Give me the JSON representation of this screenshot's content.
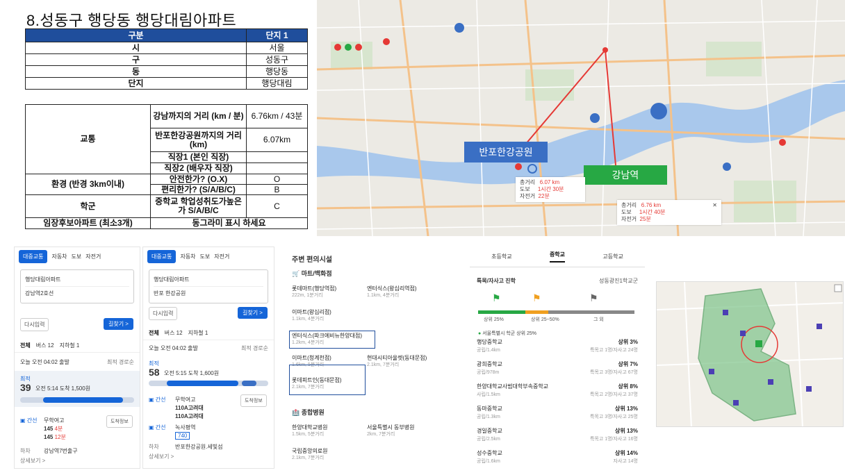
{
  "heading": "8.성동구 행당동  행당대림아파트",
  "table1": {
    "header": [
      "구분",
      "단지 1"
    ],
    "rows": [
      {
        "label": "시",
        "value": "서울"
      },
      {
        "label": "구",
        "value": "성동구"
      },
      {
        "label": "동",
        "value": "행당동"
      },
      {
        "label": "단지",
        "value": "행당대림"
      }
    ]
  },
  "table2": {
    "transport": "교통",
    "gangnam_q": "강남까지의 거리 (km / 분)",
    "gangnam_v": "6.76km / 43분",
    "banpo_q": "반포한강공원까지의 거리 (km)",
    "banpo_v": "6.07km",
    "job1": "직장1 (본인 직장)",
    "job2": "직장2 (배우자 직장)",
    "env": "환경 (반경 3km이내)",
    "safe_q": "안전한가? (O.X)",
    "safe_v": "O",
    "conv_q": "편리한가? (S/A/B/C)",
    "conv_v": "B",
    "school": "학군",
    "school_q": "중학교 학업성취도가높은가 S/A/B/C",
    "school_v": "C",
    "rent": "임장후보아파트 (최소3개)",
    "rent_v": "동그라미 표시 하세요"
  },
  "map": {
    "banpo_label": "반포한강공원",
    "gangnam_label": "강남역",
    "info1": {
      "k1": "총거리",
      "v1": "6.07 km",
      "k2": "도보",
      "v2": "1시간 30분",
      "k3": "자전거",
      "v3": "22분"
    },
    "info2": {
      "k1": "총거리",
      "v1": "6.76 km",
      "k2": "도보",
      "v2": "1시간 40분",
      "k3": "자전거",
      "v3": "25분"
    },
    "colors": {
      "water": "#a9c8ec",
      "land": "#eceae4",
      "park": "#cfe3c4",
      "banpo": "#3a6fc4",
      "gangnam": "#27a844"
    }
  },
  "route1": {
    "modes": [
      "대중교통",
      "자동차",
      "도보",
      "자전거"
    ],
    "from": "행당대림아파트",
    "to": "강남역2호선",
    "waypoint": "다시입력",
    "search": "길찾기 >",
    "tabs": [
      "전체",
      "버스 12",
      "지하철 1"
    ],
    "depart": "오늘 오전 04:02 출발",
    "sort": "최적 경로순",
    "best": "최적",
    "mins": "39",
    "summary": "오전 5:14 도착  1,500원",
    "stop1": "무학여고",
    "bus1": "145",
    "bus1_eta": "4분",
    "bus2": "145",
    "bus2_eta": "12분",
    "alight_label": "하차",
    "alight": "강남역7번출구",
    "detail": "상세보기 >",
    "stop_info": "도착정보"
  },
  "route2": {
    "modes": [
      "대중교통",
      "자동차",
      "도보",
      "자전거"
    ],
    "from": "행당대림아파트",
    "to": "반포 한강공원",
    "waypoint": "다시입력",
    "search": "길찾기 >",
    "tabs": [
      "전체",
      "버스 12",
      "지하철 1"
    ],
    "depart": "오늘 오전 04:02 출발",
    "sort": "최적 경로순",
    "best": "최적",
    "mins": "58",
    "summary": "오전 5:15 도착  1,600원",
    "stop1": "무학여고",
    "bus1": "110A고려대",
    "bus2": "110A고려대",
    "stop2": "녹사평역",
    "bus3": "740",
    "alight_label": "하차",
    "alight": "반포한강공원.세빛섬",
    "detail": "상세보기 >",
    "stop_info": "도착정보"
  },
  "amenities": {
    "title": "주변 편의시설",
    "mart_title": "마트/백화점",
    "marts": [
      {
        "name": "롯데마트(행당역점)",
        "dist": "222m, 1분거리"
      },
      {
        "name": "엔터식스(왕십리역점)",
        "dist": "1.1km, 4분거리"
      },
      {
        "name": "이마트(왕십리점)",
        "dist": "1.1km, 4분거리"
      },
      {
        "name": "엔터식스(파크에비뉴한양대점)",
        "dist": "1.2km, 4분거리"
      },
      {
        "name": "이마트(청계천점)",
        "dist": "1.6km, 5분거리"
      },
      {
        "name": "현대시티아울렛(동대문점)",
        "dist": "2.1km, 7분거리"
      },
      {
        "name": "롯데피트인(동대문점)",
        "dist": "2.1km, 7분거리"
      }
    ],
    "hosp_title": "종합병원",
    "hospitals": [
      {
        "name": "한양대학교병원",
        "dist": "1.5km, 5분거리"
      },
      {
        "name": "서울특별시 동부병원",
        "dist": "2km, 7분거리"
      },
      {
        "name": "국립중앙의료원",
        "dist": "2.1km, 7분거리"
      }
    ]
  },
  "schools": {
    "tabs": [
      "초등학교",
      "중학교",
      "고등학교"
    ],
    "section": "특목/자사고 진학",
    "region": "성동광진1학교군",
    "bar_labels": [
      "상위 25%",
      "상위 25~50%",
      "그 외"
    ],
    "bar_levels": [
      0.3,
      0.15,
      0.55
    ],
    "note": "서울특별시 학군 상위 25%",
    "list": [
      {
        "name": "행당중학교",
        "dist": "공립/1.4km",
        "rank": "상위 3%",
        "sub": "특목고 1명/자사고 24명"
      },
      {
        "name": "광희중학교",
        "dist": "공립/978m",
        "rank": "상위 7%",
        "sub": "특목고 3명/자사고 67명"
      },
      {
        "name": "한양대학교사범대학부속중학교",
        "dist": "사립/1.5km",
        "rank": "상위 8%",
        "sub": "특목고 2명/자사고 37명"
      },
      {
        "name": "동마중학교",
        "dist": "공립/1.3km",
        "rank": "상위 13%",
        "sub": "특목고 3명/자사고 25명"
      },
      {
        "name": "경일중학교",
        "dist": "공립/2.5km",
        "rank": "상위 13%",
        "sub": "특목고 1명/자사고 16명"
      },
      {
        "name": "성수중학교",
        "dist": "공립/1.6km",
        "rank": "상위 14%",
        "sub": "자사고 14명"
      }
    ]
  }
}
